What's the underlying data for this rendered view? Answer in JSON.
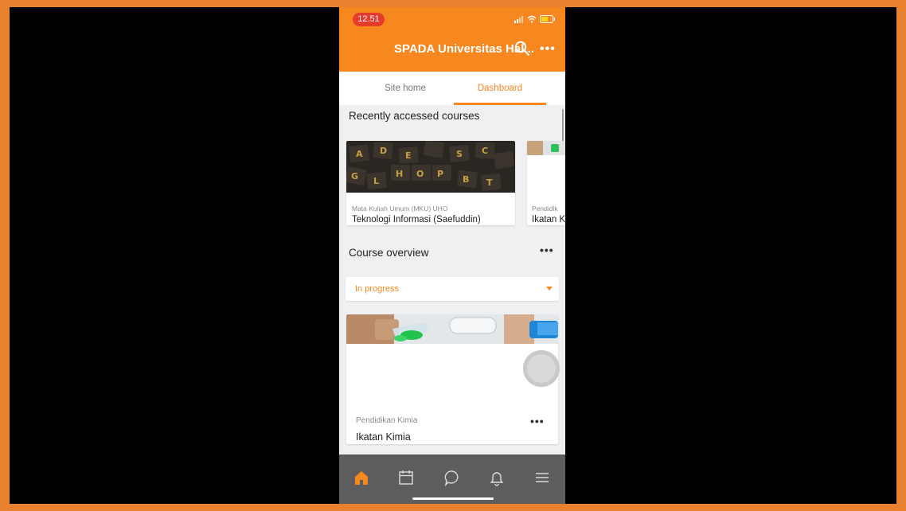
{
  "status_bar": {
    "time": "12.51",
    "icons": [
      "signal-icon",
      "wifi-icon",
      "battery-icon"
    ]
  },
  "header": {
    "title": "SPADA Universitas Hal...",
    "more_label": "•••"
  },
  "tabs": [
    {
      "label": "Site home"
    },
    {
      "label": "Dashboard",
      "active": true
    }
  ],
  "recent": {
    "title": "Recently accessed courses",
    "cards": [
      {
        "category": "Mata Kuliah Umum (MKU) UHO",
        "name": "Teknologi Informasi (Saefuddin)"
      },
      {
        "category": "Pendidik",
        "name": "Ikatan K"
      }
    ]
  },
  "overview": {
    "title": "Course overview",
    "more_label": "•••",
    "filter": {
      "selected": "In progress"
    },
    "course": {
      "category": "Pendidikan Kimia",
      "name": "Ikatan Kimia",
      "more_label": "•••"
    }
  },
  "bottom_nav": [
    "home-icon",
    "calendar-icon",
    "messages-icon",
    "notifications-icon",
    "menu-icon"
  ],
  "colors": {
    "accent": "#f7871f",
    "nav_bg": "#5d5d5d",
    "frame_border": "#e8822f"
  }
}
